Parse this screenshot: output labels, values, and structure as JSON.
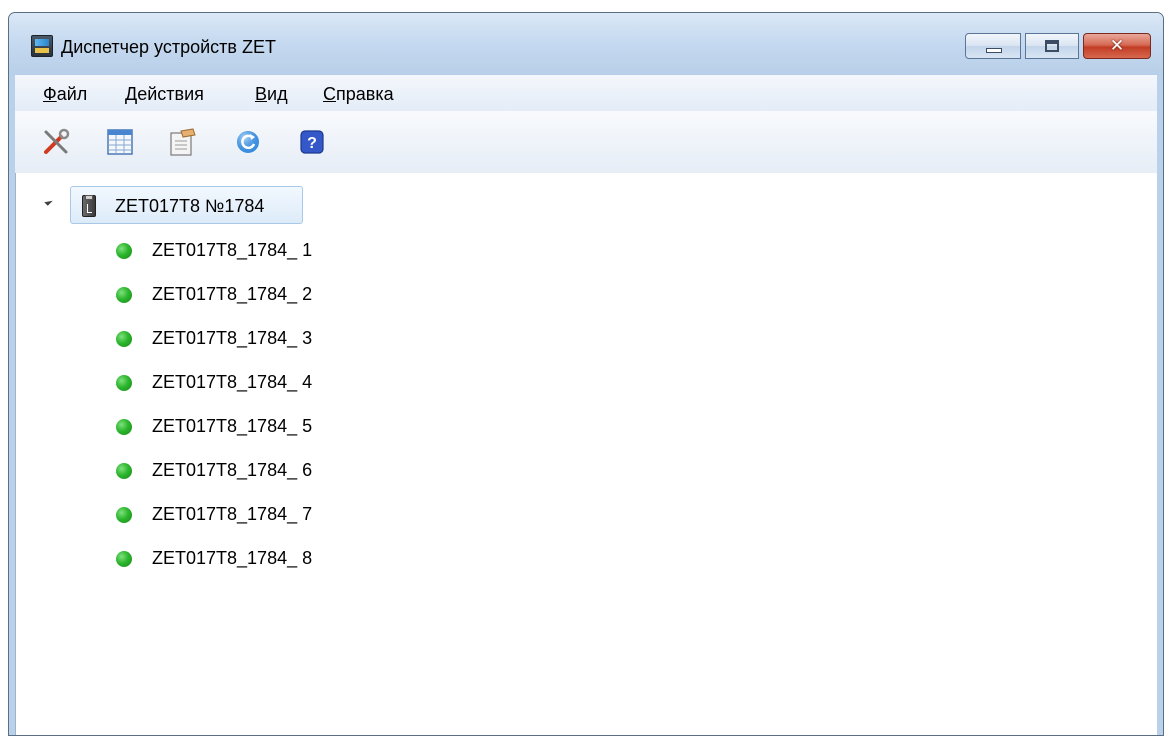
{
  "window": {
    "title": "Диспетчер устройств ZET",
    "close_glyph": "✕"
  },
  "menu": {
    "items": [
      {
        "accel": "Ф",
        "rest": "айл"
      },
      {
        "accel": "Д",
        "rest": "ействия"
      },
      {
        "accel": "В",
        "rest": "ид"
      },
      {
        "accel": "С",
        "rest": "правка"
      }
    ]
  },
  "toolbar": {
    "icons": [
      "tools-icon",
      "table-icon",
      "properties-icon",
      "refresh-icon",
      "help-icon"
    ],
    "help_glyph": "?"
  },
  "tree": {
    "root": {
      "label": "ZET017T8 №1784",
      "icon": "usb-device-icon",
      "expanded": true
    },
    "status_color": "#2db62d",
    "channels": [
      "ZET017T8_1784_ 1",
      "ZET017T8_1784_ 2",
      "ZET017T8_1784_ 3",
      "ZET017T8_1784_ 4",
      "ZET017T8_1784_ 5",
      "ZET017T8_1784_ 6",
      "ZET017T8_1784_ 7",
      "ZET017T8_1784_ 8"
    ]
  }
}
